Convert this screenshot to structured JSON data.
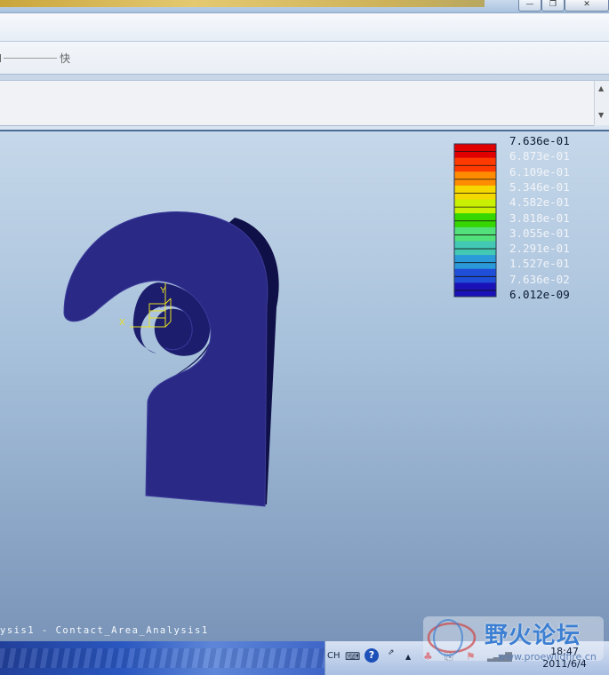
{
  "window": {
    "minimize_glyph": "—",
    "restore_glyph": "❐",
    "close_glyph": "✕"
  },
  "toolbar": {
    "speed_label": "快"
  },
  "legend": {
    "values": [
      "7.636e-01",
      "6.873e-01",
      "6.109e-01",
      "5.346e-01",
      "4.582e-01",
      "3.818e-01",
      "3.055e-01",
      "2.291e-01",
      "1.527e-01",
      "7.636e-02",
      "6.012e-09"
    ],
    "colors": [
      "#e00000",
      "#ff3a00",
      "#ff8c00",
      "#f4d800",
      "#c8f000",
      "#36d600",
      "#52e07a",
      "#43c8b4",
      "#2a9bd8",
      "#1f4fd8",
      "#1a12b8"
    ]
  },
  "model": {
    "color": "#2a2a86",
    "axis_color": "#e8e020",
    "axis_x": "X",
    "axis_y": "Y"
  },
  "status": {
    "text": "ysis1 - Contact_Area_Analysis1"
  },
  "taskbar": {
    "lang": "CH",
    "time": "18:47",
    "date": "2011/6/4"
  },
  "watermark": {
    "title": "野火论坛",
    "url": "www.proewildfire.cn"
  }
}
